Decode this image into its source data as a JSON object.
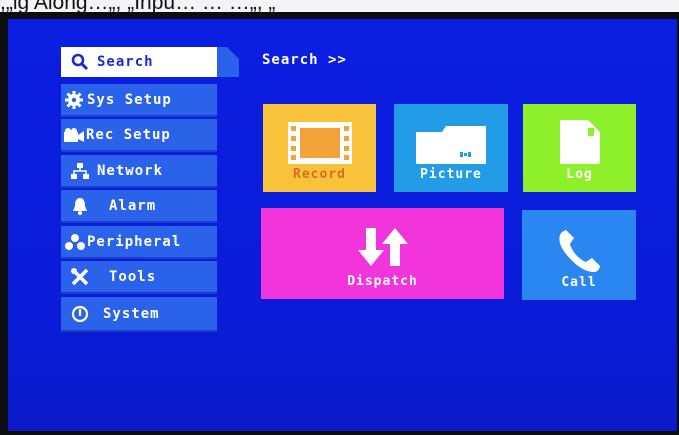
{
  "caption": ",„lg Along…„, „Inpu…  …  …„, „",
  "sidebar": {
    "items": [
      {
        "label": "Search",
        "icon": "search-icon",
        "active": true
      },
      {
        "label": "Sys Setup",
        "icon": "gear-icon",
        "active": false
      },
      {
        "label": "Rec Setup",
        "icon": "camera-icon",
        "active": false
      },
      {
        "label": "Network",
        "icon": "network-icon",
        "active": false
      },
      {
        "label": "Alarm",
        "icon": "bell-icon",
        "active": false
      },
      {
        "label": "Peripheral",
        "icon": "peripheral-icon",
        "active": false
      },
      {
        "label": "Tools",
        "icon": "tools-icon",
        "active": false
      },
      {
        "label": "System",
        "icon": "power-icon",
        "active": false
      }
    ]
  },
  "breadcrumb": "Search >>",
  "tiles": {
    "record": {
      "label": "Record",
      "icon": "film-icon",
      "color": "#f9c23b"
    },
    "picture": {
      "label": "Picture",
      "icon": "folder-icon",
      "color": "#239ce8"
    },
    "log": {
      "label": "Log",
      "icon": "document-icon",
      "color": "#8ef02a"
    },
    "dispatch": {
      "label": "Dispatch",
      "icon": "transfer-icon",
      "color": "#f234dc"
    },
    "call": {
      "label": "Call",
      "icon": "phone-icon",
      "color": "#2a86f0"
    }
  },
  "colors": {
    "screen_background": "#0a1ddd",
    "sidebar_item": "#2a62ea",
    "sidebar_active": "#ffffff"
  }
}
